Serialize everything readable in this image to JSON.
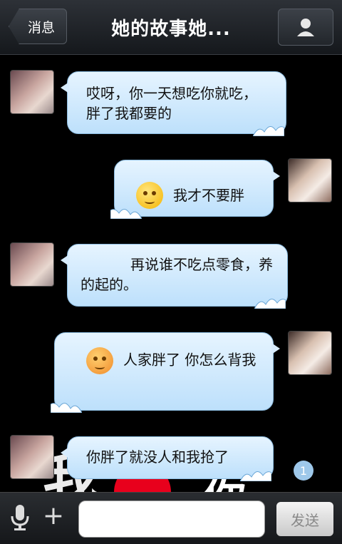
{
  "header": {
    "back_label": "消息",
    "title": "她的故事她...",
    "profile_icon": "person-icon"
  },
  "messages": [
    {
      "side": "left",
      "text": "哎呀，你一天想吃你就吃，胖了我都要的"
    },
    {
      "side": "right",
      "emoji": "shy-face-icon",
      "text": "我才不要胖"
    },
    {
      "side": "left",
      "text": "再说谁不吃点零食，养的起的。"
    },
    {
      "side": "right",
      "emoji": "blushing-face-icon",
      "text": "人家胖了 你怎么背我"
    },
    {
      "side": "left",
      "text": "你胖了就没人和我抢了"
    }
  ],
  "unread_badge": "1",
  "wallpaper": {
    "text1": "我",
    "text2": "你"
  },
  "composer": {
    "mic_icon": "microphone-icon",
    "plus_icon": "plus-icon",
    "input_value": "",
    "send_label": "发送"
  }
}
